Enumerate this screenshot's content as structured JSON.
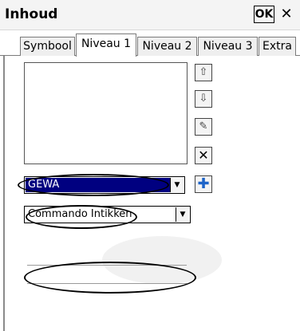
{
  "window": {
    "title": "Inhoud",
    "ok_label": "OK",
    "close_glyph": "✕"
  },
  "tabs": [
    {
      "label": "Symbool",
      "active": false
    },
    {
      "label": "Niveau 1",
      "active": true
    },
    {
      "label": "Niveau 2",
      "active": false
    },
    {
      "label": "Niveau 3",
      "active": false
    },
    {
      "label": "Extra",
      "active": false
    }
  ],
  "side_buttons": {
    "up": {
      "icon": "arrow-up-icon",
      "glyph": "⇧"
    },
    "down": {
      "icon": "arrow-down-icon",
      "glyph": "⇩"
    },
    "edit": {
      "icon": "edit-document-icon",
      "glyph": "✎"
    },
    "delete": {
      "icon": "delete-icon",
      "glyph": "✕"
    }
  },
  "gewa_combo": {
    "value": "GEWA",
    "selected": true
  },
  "add_button": {
    "icon": "plus-icon",
    "glyph": "✚"
  },
  "command_combo": {
    "value": "Commando Intikken"
  },
  "text_field": {
    "value": ""
  },
  "colors": {
    "selection": "#000080",
    "add_icon": "#1e64c8"
  }
}
